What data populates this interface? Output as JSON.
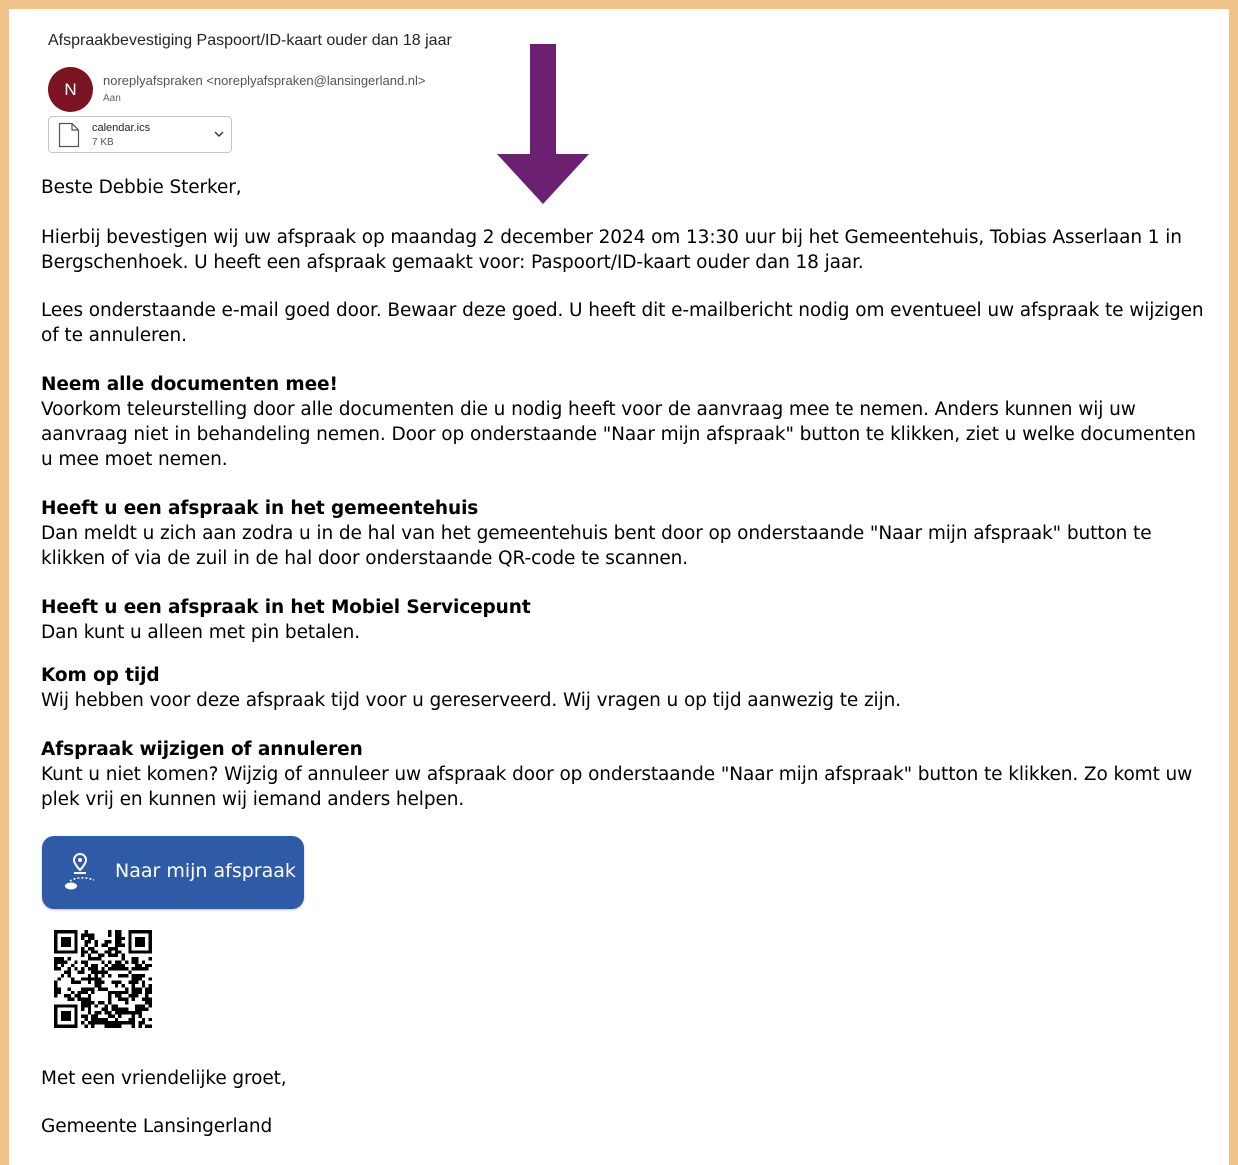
{
  "email": {
    "subject": "Afspraakbevestiging Paspoort/ID-kaart ouder dan 18 jaar",
    "avatar_initial": "N",
    "sender": "noreplyafspraken <noreplyafspraken@lansingerland.nl>",
    "recipient_label": "Aan"
  },
  "attachment": {
    "name": "calendar.ics",
    "size": "7 KB"
  },
  "body": {
    "greeting": "Beste Debbie Sterker,",
    "confirmation": "Hierbij bevestigen wij uw afspraak op maandag 2 december 2024 om 13:30 uur bij het Gemeentehuis, Tobias Asserlaan 1 in Bergschenhoek. U heeft een afspraak gemaakt voor: Paspoort/ID-kaart ouder dan 18 jaar.",
    "read_notice": "Lees onderstaande e-mail goed door. Bewaar deze goed. U heeft dit e-mailbericht nodig om eventueel uw afspraak te wijzigen of te annuleren.",
    "sections": [
      {
        "heading": "Neem alle documenten mee!",
        "text": "Voorkom teleurstelling door alle documenten die u nodig heeft voor de aanvraag mee te nemen. Anders kunnen wij uw aanvraag niet in behandeling nemen. Door op onderstaande \"Naar mijn afspraak\" button te klikken, ziet u welke documenten u mee moet nemen."
      },
      {
        "heading": "Heeft u een afspraak in het gemeentehuis",
        "text": "Dan meldt u zich aan zodra u in de hal van het gemeentehuis bent door op onderstaande \"Naar mijn afspraak\" button te klikken of via de zuil in de hal door onderstaande QR-code te scannen."
      },
      {
        "heading": "Heeft u een afspraak in het Mobiel Servicepunt",
        "text": "Dan kunt u alleen met pin betalen."
      },
      {
        "heading": "Kom op tijd",
        "text": "Wij hebben voor deze afspraak tijd voor u gereserveerd. Wij vragen u op tijd aanwezig te zijn."
      },
      {
        "heading": "Afspraak wijzigen of annuleren",
        "text": "Kunt u niet komen? Wijzig of annuleer uw afspraak door op onderstaande \"Naar mijn afspraak\" button te klikken. Zo komt uw plek vrij en kunnen wij iemand anders helpen."
      }
    ],
    "button_label": "Naar mijn afspraak",
    "closing": "Met een vriendelijke groet,",
    "signature": "Gemeente Lansingerland"
  },
  "icons": {
    "annotation_arrow": "arrow-down-icon",
    "file": "file-icon",
    "chevron": "chevron-down-icon",
    "location": "location-route-icon"
  },
  "colors": {
    "frame_border": "#f0c48a",
    "avatar_bg": "#7a1420",
    "annotation_arrow": "#6b2072",
    "button_bg": "#2e5aa6"
  }
}
